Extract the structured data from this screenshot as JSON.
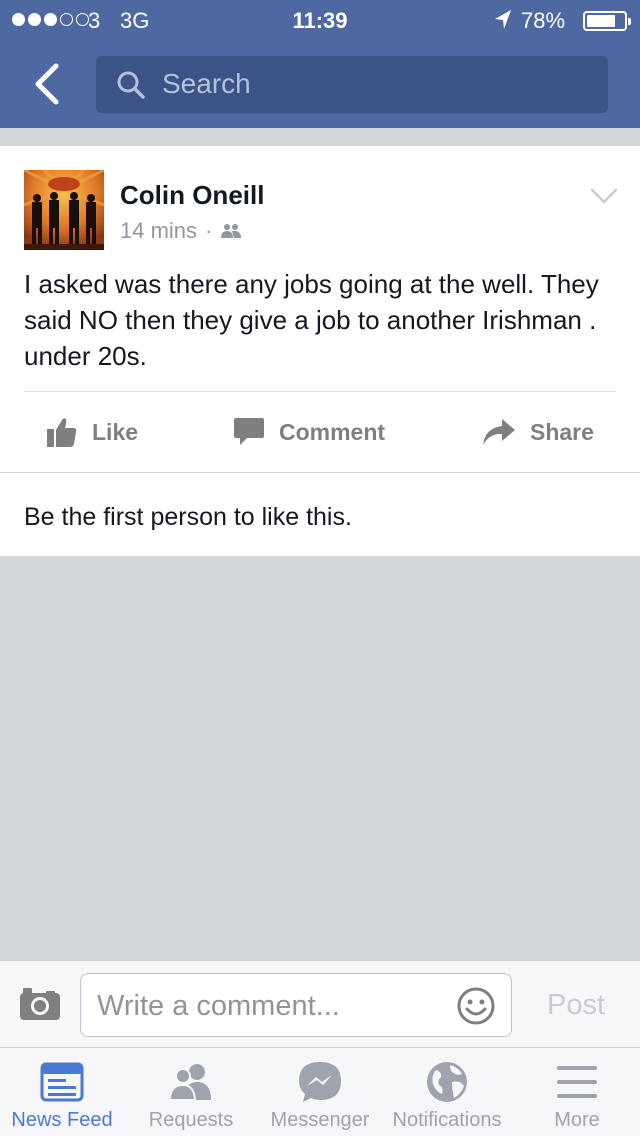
{
  "status_bar": {
    "carrier": "3",
    "network": "3G",
    "time": "11:39",
    "battery": "78%",
    "battery_level": 0.78
  },
  "nav": {
    "back_icon": "chevron-left-icon",
    "search_placeholder": "Search"
  },
  "post": {
    "author": "Colin Oneill",
    "time": "14 mins",
    "separator": "·",
    "audience_icon": "friends-icon",
    "text": "I asked was there any jobs going at the well. They said NO then they give a job to another Irishman . under 20s.",
    "actions": {
      "like": "Like",
      "comment": "Comment",
      "share": "Share"
    }
  },
  "likes_summary": "Be the first person to like this.",
  "composer": {
    "placeholder": "Write a comment...",
    "post_label": "Post"
  },
  "tabs": [
    {
      "label": "News Feed",
      "icon": "news-feed-icon",
      "active": true
    },
    {
      "label": "Requests",
      "icon": "friend-requests-icon",
      "active": false
    },
    {
      "label": "Messenger",
      "icon": "messenger-icon",
      "active": false
    },
    {
      "label": "Notifications",
      "icon": "globe-icon",
      "active": false
    },
    {
      "label": "More",
      "icon": "menu-icon",
      "active": false
    }
  ],
  "colors": {
    "brand_blue": "#4e69a2",
    "search_bg": "#3b5386",
    "active_tab": "#4a78d4",
    "inactive_icon": "#9ea3ae"
  }
}
